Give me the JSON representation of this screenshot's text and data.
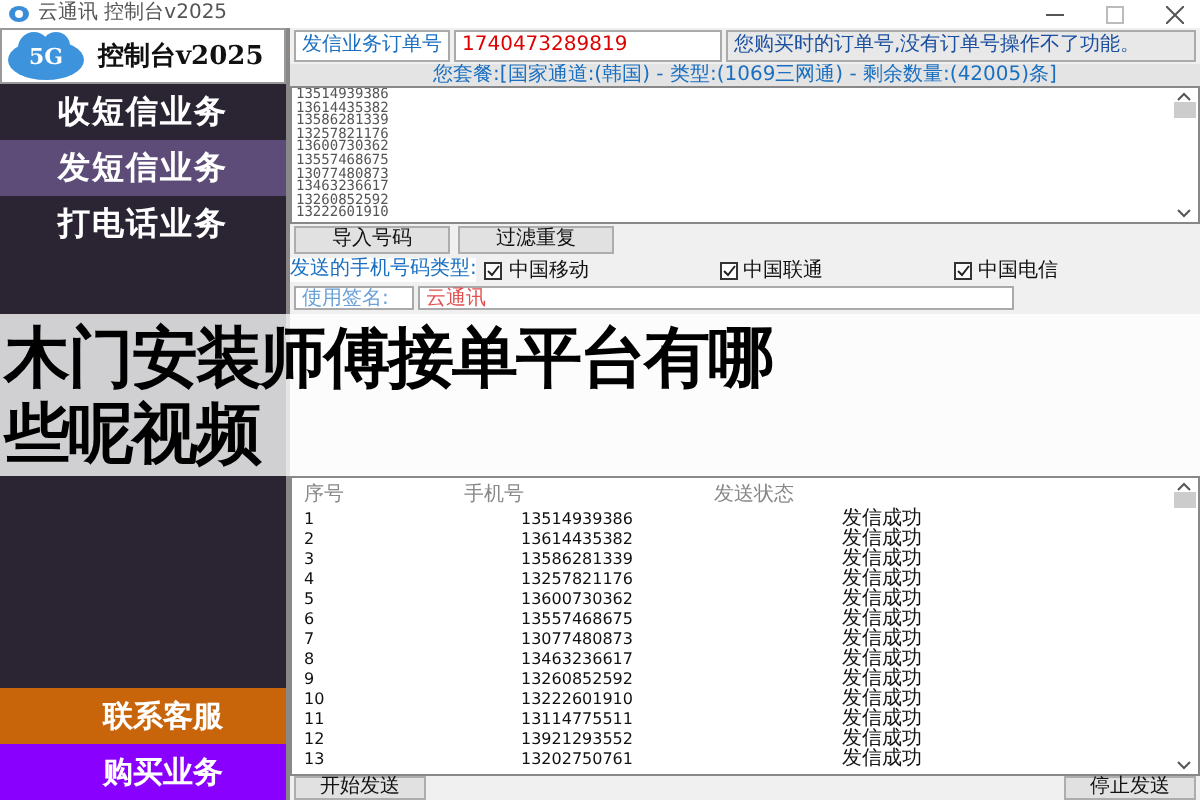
{
  "window": {
    "title": "云通讯 控制台v2025"
  },
  "logo": {
    "badge": "5G",
    "title": "控制台v2025"
  },
  "sidebar": {
    "items": [
      {
        "label": "收短信业务",
        "selected": false
      },
      {
        "label": "发短信业务",
        "selected": true
      },
      {
        "label": "打电话业务",
        "selected": false
      }
    ],
    "bottom_items": [
      {
        "label": "联系客服",
        "color": "#c8650a"
      },
      {
        "label": "购买业务",
        "color": "#8a00ff"
      }
    ]
  },
  "order": {
    "label": "发信业务订单号",
    "value": "1740473289819",
    "hint": "您购买时的订单号,没有订单号操作不了功能。"
  },
  "package": "您套餐:[国家通道:(韩国) - 类型:(1069三网通) - 剩余数量:(42005)条]",
  "numbers": [
    "13514939386",
    "13614435382",
    "13586281339",
    "13257821176",
    "13600730362",
    "13557468675",
    "13077480873",
    "13463236617",
    "13260852592",
    "13222601910"
  ],
  "import_buttons": [
    "导入号码",
    "过滤重复"
  ],
  "carrier_filter": {
    "label": "发送的手机号码类型:",
    "options": [
      {
        "label": "中国移动",
        "checked": true
      },
      {
        "label": "中国联通",
        "checked": true
      },
      {
        "label": "中国电信",
        "checked": true
      }
    ]
  },
  "signature": {
    "label": "使用签名:",
    "value": "云通讯"
  },
  "overlay_caption": "木门安装师傅接单平台有哪些呢视频",
  "table": {
    "columns": [
      "序号",
      "手机号",
      "发送状态"
    ],
    "rows": [
      [
        "1",
        "13514939386",
        "发信成功"
      ],
      [
        "2",
        "13614435382",
        "发信成功"
      ],
      [
        "3",
        "13586281339",
        "发信成功"
      ],
      [
        "4",
        "13257821176",
        "发信成功"
      ],
      [
        "5",
        "13600730362",
        "发信成功"
      ],
      [
        "6",
        "13557468675",
        "发信成功"
      ],
      [
        "7",
        "13077480873",
        "发信成功"
      ],
      [
        "8",
        "13463236617",
        "发信成功"
      ],
      [
        "9",
        "13260852592",
        "发信成功"
      ],
      [
        "10",
        "13222601910",
        "发信成功"
      ],
      [
        "11",
        "13114775511",
        "发信成功"
      ],
      [
        "12",
        "13921293552",
        "发信成功"
      ],
      [
        "13",
        "13202750761",
        "发信成功"
      ]
    ]
  },
  "buttons": [
    "开始发送",
    "停止发送"
  ]
}
